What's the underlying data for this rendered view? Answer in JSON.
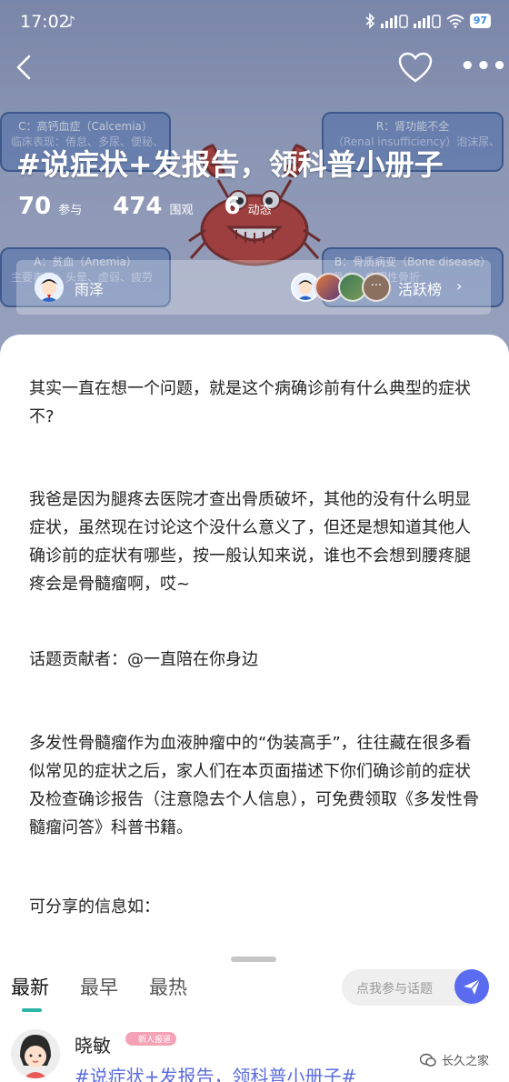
{
  "status_bar": {
    "time": "17:02",
    "battery": "97",
    "icons": [
      "tiktok-icon",
      "bluetooth-icon",
      "signal-icon",
      "signal-icon",
      "wifi-icon",
      "battery-icon"
    ]
  },
  "nav": {
    "icons": [
      "back-icon",
      "heart-icon",
      "more-icon"
    ]
  },
  "background_boxes": [
    {
      "title": "C：高钙血症（Calcemia）",
      "body": "临床表现：倦怠、多尿、便秘、恶心、呕吐、意识模糊甚至心律"
    },
    {
      "title": "R：肾功能不全",
      "body": "（Renal insufficiency）泡沫尿、血尿、水肿、少尿"
    },
    {
      "title": "A：贫血（Anemia）",
      "body": "主要表现：头晕、虚弱、疲劳"
    },
    {
      "title": "B：骨质病变（Bone disease）",
      "body": "骨痛、病理性骨折"
    }
  ],
  "topic": {
    "title": "#说症状+发报告，领科普小册子",
    "stats": [
      {
        "value": "70",
        "label": "参与"
      },
      {
        "value": "474",
        "label": "围观"
      },
      {
        "value": "6",
        "label": "动态"
      }
    ],
    "host_name": "雨泽",
    "more_dots": "···",
    "rank_label": "活跃榜",
    "rank_arrow": "›"
  },
  "content": {
    "paragraphs": [
      "其实一直在想一个问题，就是这个病确诊前有什么典型的症状不?",
      "我爸是因为腿疼去医院才查出骨质破坏，其他的没有什么明显症状，虽然现在讨论这个没什么意义了，但还是想知道其他人确诊前的症状有哪些，按一般认知来说，谁也不会想到腰疼腿疼会是骨髓瘤啊，哎~",
      "话题贡献者：@一直陪在你身边",
      "多发性骨髓瘤作为血液肿瘤中的“伪装高手”，往往藏在很多看似常见的症状之后，家人们在本页面描述下你们确诊前的症状及检查确诊报告（注意隐去个人信息），可免费领取《多发性骨髓瘤问答》科普书籍。",
      "可分享的信息如："
    ]
  },
  "tabs": [
    "最新",
    "最早",
    "最热"
  ],
  "join": {
    "placeholder": "点我参与话题"
  },
  "post": {
    "author": "晓敏",
    "badge": "新人报道",
    "topic_tag": "#说症状+发报告，领科普小册子#"
  },
  "watermark": "长久之家",
  "colors": {
    "accent_teal": "#2bb5a6",
    "send_button": "#5a6bf0",
    "topic_link": "#5b6cdc"
  }
}
